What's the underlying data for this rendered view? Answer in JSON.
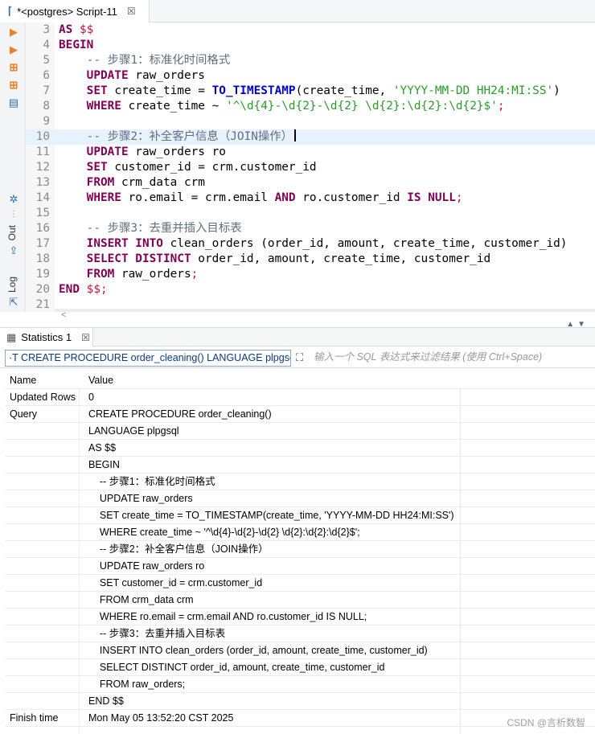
{
  "editor_tab": {
    "title": "*<postgres> Script-11",
    "close": "☒"
  },
  "left_toolbar": {
    "out_label": "Out",
    "log_label": "Log"
  },
  "code": [
    {
      "n": "3",
      "t": [
        [
          "kw",
          "AS "
        ],
        [
          "dol",
          "$$"
        ]
      ]
    },
    {
      "n": "4",
      "t": [
        [
          "kw",
          "BEGIN"
        ]
      ]
    },
    {
      "n": "5",
      "t": [
        [
          "",
          "    "
        ],
        [
          "cm",
          "-- 步骤1：标准化时间格式"
        ]
      ]
    },
    {
      "n": "6",
      "t": [
        [
          "",
          "    "
        ],
        [
          "kw",
          "UPDATE"
        ],
        [
          "",
          " raw_orders"
        ]
      ]
    },
    {
      "n": "7",
      "t": [
        [
          "",
          "    "
        ],
        [
          "kw",
          "SET"
        ],
        [
          "",
          " create_time = "
        ],
        [
          "fn",
          "TO_TIMESTAMP"
        ],
        [
          "",
          "(create_time, "
        ],
        [
          "str",
          "'YYYY-MM-DD HH24:MI:SS'"
        ],
        [
          "",
          ")"
        ]
      ]
    },
    {
      "n": "8",
      "t": [
        [
          "",
          "    "
        ],
        [
          "kw",
          "WHERE"
        ],
        [
          "",
          " create_time ~ "
        ],
        [
          "str",
          "'^\\d{4}-\\d{2}-\\d{2} \\d{2}:\\d{2}:\\d{2}$'"
        ],
        [
          "dol",
          ";"
        ]
      ]
    },
    {
      "n": "9",
      "t": []
    },
    {
      "n": "10",
      "t": [
        [
          "",
          "    "
        ],
        [
          "cm",
          "-- 步骤2：补全客户信息（JOIN操作）"
        ]
      ],
      "current": true
    },
    {
      "n": "11",
      "t": [
        [
          "",
          "    "
        ],
        [
          "kw",
          "UPDATE"
        ],
        [
          "",
          " raw_orders ro"
        ]
      ]
    },
    {
      "n": "12",
      "t": [
        [
          "",
          "    "
        ],
        [
          "kw",
          "SET"
        ],
        [
          "",
          " customer_id = crm.customer_id"
        ]
      ]
    },
    {
      "n": "13",
      "t": [
        [
          "",
          "    "
        ],
        [
          "kw",
          "FROM"
        ],
        [
          "",
          " crm_data crm"
        ]
      ]
    },
    {
      "n": "14",
      "t": [
        [
          "",
          "    "
        ],
        [
          "kw",
          "WHERE"
        ],
        [
          "",
          " ro.email = crm.email "
        ],
        [
          "kw",
          "AND"
        ],
        [
          "",
          " ro.customer_id "
        ],
        [
          "kw",
          "IS NULL"
        ],
        [
          "dol",
          ";"
        ]
      ]
    },
    {
      "n": "15",
      "t": []
    },
    {
      "n": "16",
      "t": [
        [
          "",
          "    "
        ],
        [
          "cm",
          "-- 步骤3：去重并插入目标表"
        ]
      ]
    },
    {
      "n": "17",
      "t": [
        [
          "",
          "    "
        ],
        [
          "kw",
          "INSERT INTO"
        ],
        [
          "",
          " clean_orders (order_id, amount, create_time, customer_id)"
        ]
      ]
    },
    {
      "n": "18",
      "t": [
        [
          "",
          "    "
        ],
        [
          "kw",
          "SELECT DISTINCT"
        ],
        [
          "",
          " order_id, amount, create_time, customer_id"
        ]
      ]
    },
    {
      "n": "19",
      "t": [
        [
          "",
          "    "
        ],
        [
          "kw",
          "FROM"
        ],
        [
          "",
          " raw_orders"
        ],
        [
          "dol",
          ";"
        ]
      ]
    },
    {
      "n": "20",
      "t": [
        [
          "kw",
          "END "
        ],
        [
          "dol",
          "$$;"
        ]
      ]
    },
    {
      "n": "21",
      "t": []
    }
  ],
  "results_tab": {
    "title": "Statistics 1",
    "close": "☒"
  },
  "filter": {
    "query_text": "·T CREATE PROCEDURE order_cleaning() LANGUAGE plpgsql AS $$",
    "placeholder": "输入一个 SQL 表达式来过滤结果 (使用 Ctrl+Space)"
  },
  "stats": {
    "headers": [
      "Name",
      "Value"
    ],
    "rows": [
      [
        "Updated Rows",
        "0"
      ],
      [
        "Query",
        "CREATE PROCEDURE order_cleaning()"
      ],
      [
        "",
        "LANGUAGE plpgsql"
      ],
      [
        "",
        "AS $$"
      ],
      [
        "",
        "BEGIN"
      ],
      [
        "",
        "    -- 步骤1：标准化时间格式"
      ],
      [
        "",
        "    UPDATE raw_orders"
      ],
      [
        "",
        "    SET create_time = TO_TIMESTAMP(create_time, 'YYYY-MM-DD HH24:MI:SS')"
      ],
      [
        "",
        "    WHERE create_time ~ '^\\d{4}-\\d{2}-\\d{2} \\d{2}:\\d{2}:\\d{2}$';"
      ],
      [
        "",
        "    -- 步骤2：补全客户信息（JOIN操作）"
      ],
      [
        "",
        "    UPDATE raw_orders ro"
      ],
      [
        "",
        "    SET customer_id = crm.customer_id"
      ],
      [
        "",
        "    FROM crm_data crm"
      ],
      [
        "",
        "    WHERE ro.email = crm.email AND ro.customer_id IS NULL;"
      ],
      [
        "",
        "    -- 步骤3：去重并插入目标表"
      ],
      [
        "",
        "    INSERT INTO clean_orders (order_id, amount, create_time, customer_id)"
      ],
      [
        "",
        "    SELECT DISTINCT order_id, amount, create_time, customer_id"
      ],
      [
        "",
        "    FROM raw_orders;"
      ],
      [
        "",
        "END $$"
      ],
      [
        "Finish time",
        "Mon May 05 13:52:20 CST 2025"
      ]
    ]
  },
  "watermark": "CSDN @言析数智"
}
